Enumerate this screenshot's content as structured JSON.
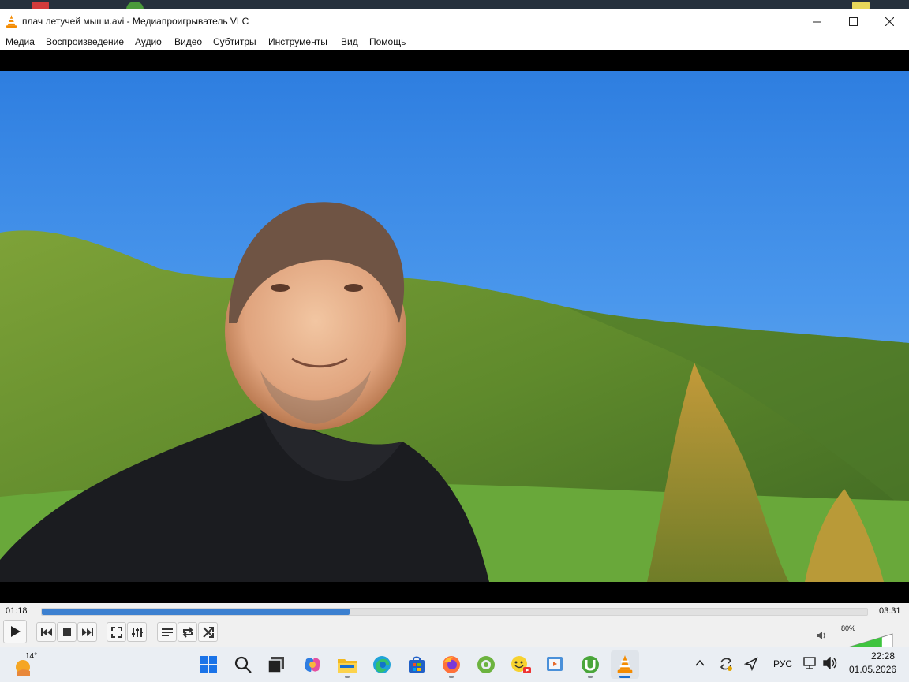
{
  "window": {
    "title": "плач летучей мыши.avi - Медиапроигрыватель VLC",
    "controls": [
      "minimize",
      "maximize",
      "close"
    ]
  },
  "menu": {
    "items": [
      "Медиа",
      "Воспроизведение",
      "Аудио",
      "Видео",
      "Субтитры",
      "Инструменты",
      "Вид",
      "Помощь"
    ]
  },
  "player": {
    "elapsed": "01:18",
    "total": "03:31",
    "progress": 0.373,
    "volume_label": "80%",
    "volume": 0.8,
    "buttons": [
      "play-icon",
      "previous-icon",
      "stop-icon",
      "next-icon",
      "fullscreen-icon",
      "extended-settings-icon",
      "playlist-icon",
      "loop-icon",
      "shuffle-icon",
      "speaker-icon"
    ]
  },
  "taskbar": {
    "weather_temp": "14°",
    "apps": [
      "start-icon",
      "search-icon",
      "task-view-icon",
      "copilot-icon",
      "file-explorer-icon",
      "edge-icon",
      "store-icon",
      "firefox-icon",
      "media-icon",
      "emoji-app-icon",
      "video-editor-icon",
      "utorrent-icon",
      "vlc-icon"
    ],
    "language": "РУС",
    "time": "22:28",
    "date": "01.05.2026"
  },
  "colors": {
    "accent": "#3c80d0",
    "vlc_orange": "#f48b00",
    "volume_green": "#3fc43f"
  }
}
